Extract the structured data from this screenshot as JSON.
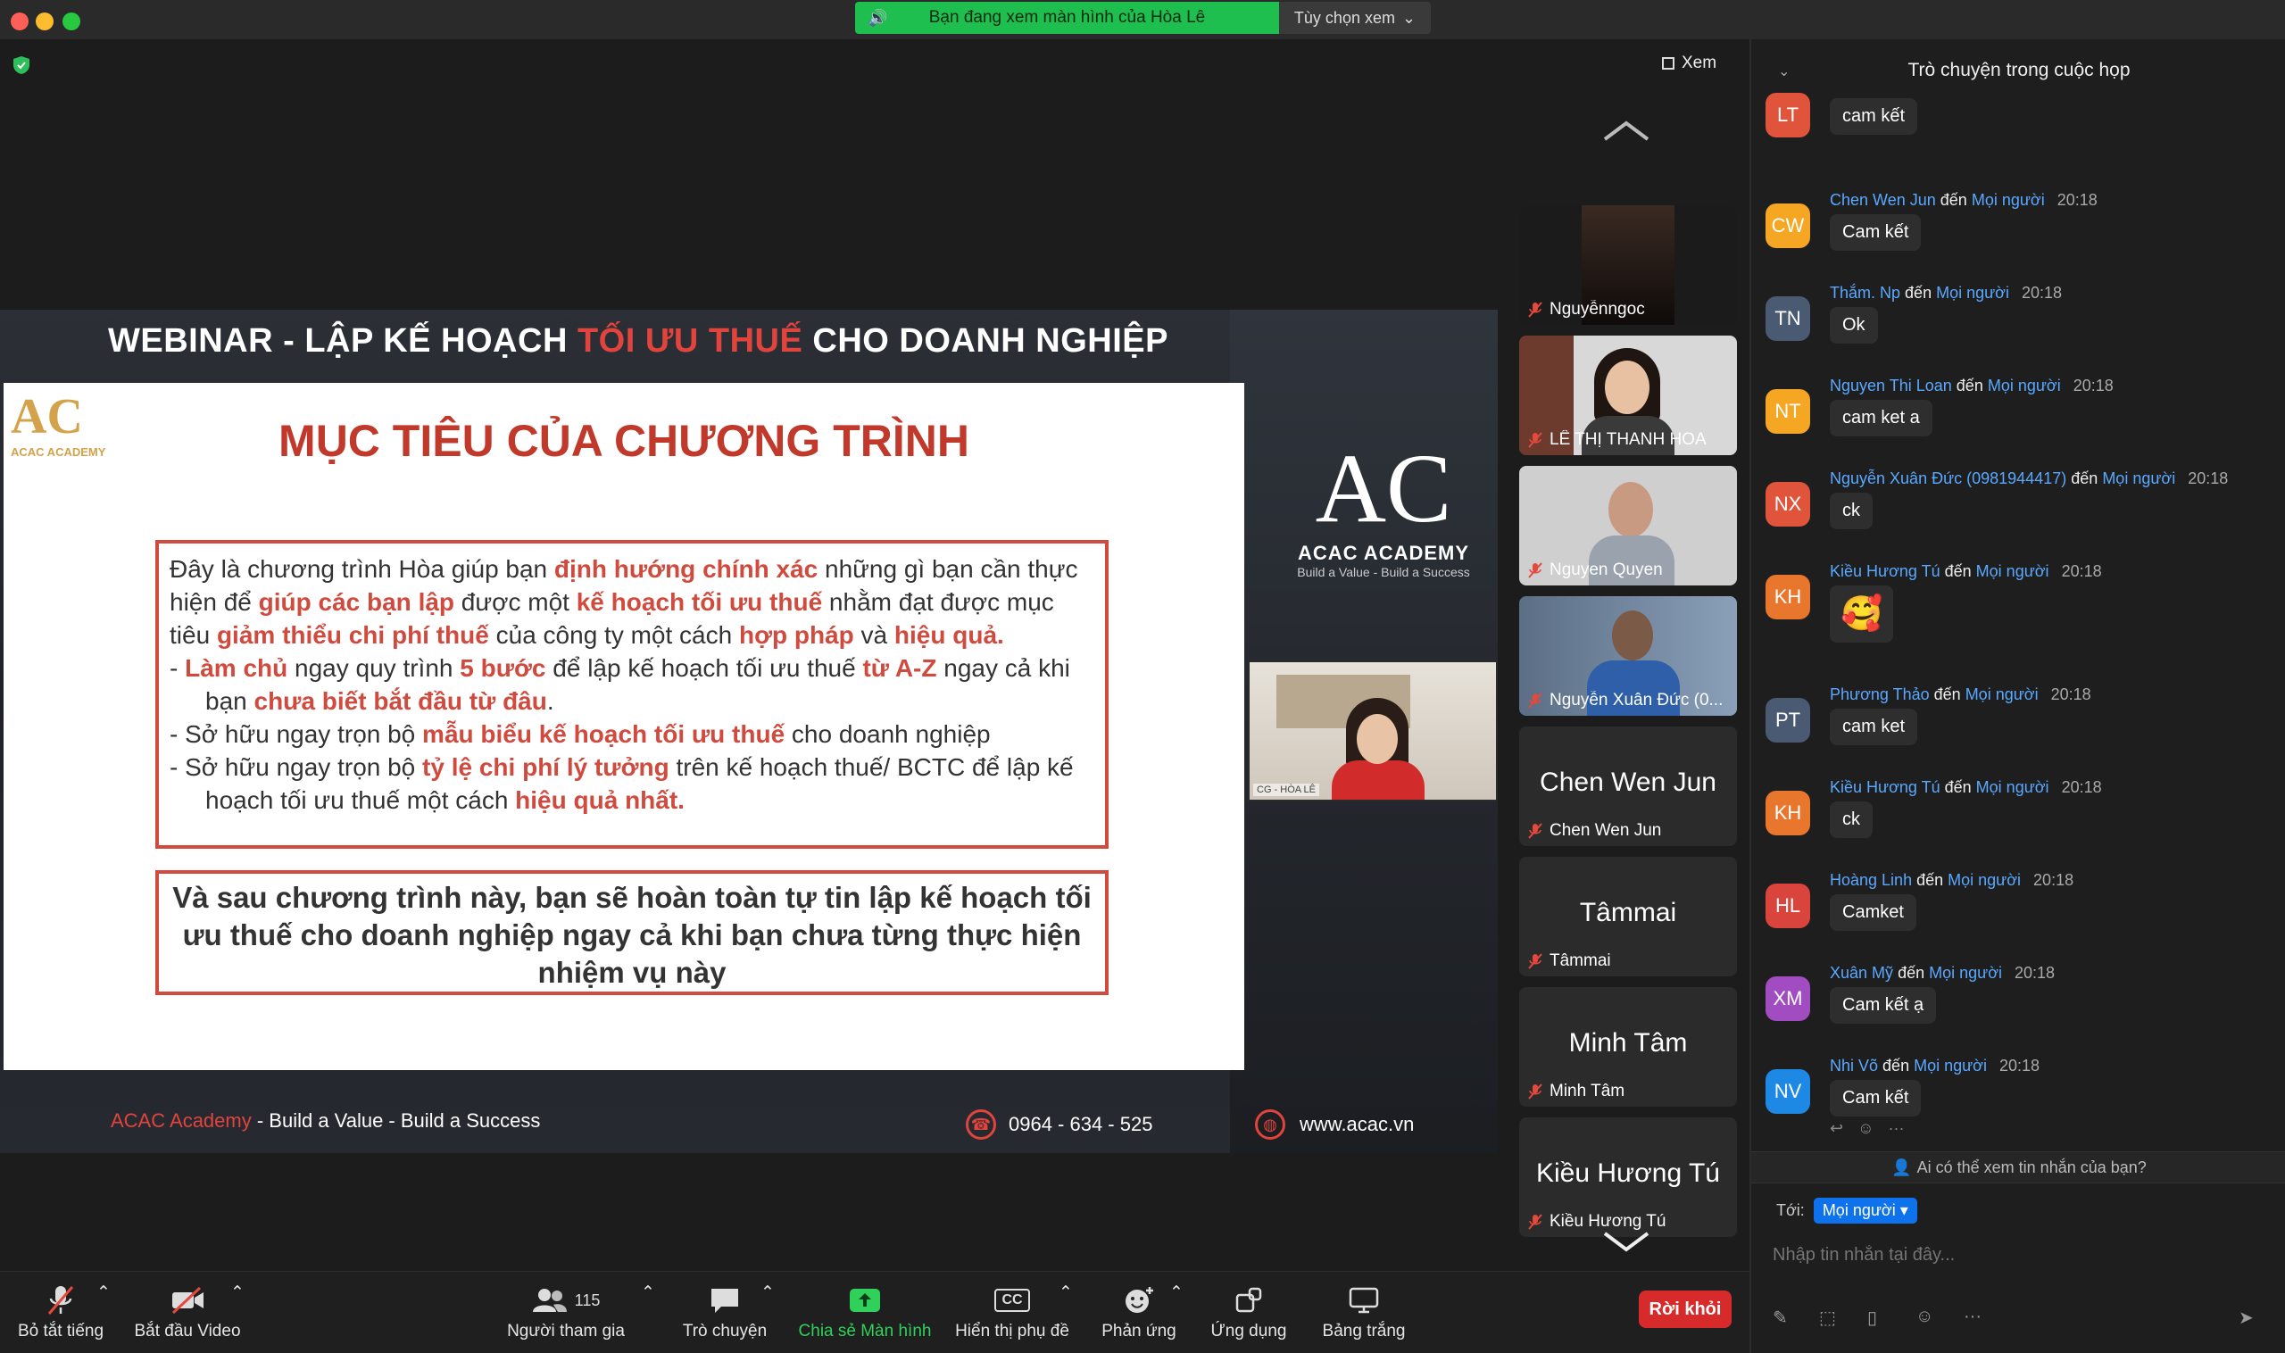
{
  "titlebar": {
    "sharing_banner": "Bạn đang xem màn hình của Hòa Lê",
    "view_options": "Tùy chọn xem"
  },
  "stage": {
    "view_label": "Xem",
    "slide": {
      "title_part1": "WEBINAR - LẬP KẾ HOẠCH ",
      "title_highlight": "TỐI ƯU THUẾ",
      "title_part2": " CHO DOANH NGHIỆP",
      "logo_text": "ACAC ACADEMY",
      "heading": "MỤC TIÊU CỦA CHƯƠNG TRÌNH",
      "box1": {
        "p1": [
          "Đây là chương trình Hòa giúp bạn ",
          "định hướng chính xác",
          " những gì bạn cần thực hiện để ",
          "giúp các bạn lập",
          " được một ",
          "kế hoạch tối ưu thuế",
          " nhằm đạt được mục tiêu ",
          "giảm thiểu chi phí thuế",
          " của công ty một cách ",
          "hợp pháp",
          " và ",
          "hiệu quả."
        ],
        "b1": [
          "- ",
          "Làm chủ",
          " ngay quy trình ",
          "5 bước",
          " để lập kế hoạch tối ưu thuế ",
          "từ A-Z",
          " ngay cả khi bạn ",
          "chưa biết bắt đầu từ đâu",
          "."
        ],
        "b2": [
          "- Sở hữu ngay trọn bộ ",
          "mẫu biểu kế hoạch tối ưu thuế",
          " cho doanh nghiệp"
        ],
        "b3": [
          "- Sở hữu ngay trọn bộ ",
          "tỷ lệ chi phí lý tưởng",
          " trên kế hoạch thuế/ BCTC để lập kế hoạch tối ưu thuế một cách ",
          "hiệu quả nhất."
        ]
      },
      "box2": "Và sau chương trình này, bạn sẽ hoàn toàn tự tin lập kế hoạch tối ưu thuế cho doanh nghiệp ngay cả khi bạn chưa từng thực hiện nhiệm vụ này",
      "brand_name": "ACAC ACADEMY",
      "brand_tag": "Build a Value - Build a Success",
      "footer_brand": "ACAC Academy",
      "footer_slogan": " - Build a Value - Build a Success",
      "footer_phone": "0964 - 634 - 525",
      "footer_web": "www.acac.vn"
    },
    "presenter_tag": "CG - HÒA LÊ"
  },
  "gallery": [
    {
      "name": "Nguyễnngoc",
      "big": "",
      "video": "dark"
    },
    {
      "name": "LÊ THỊ THANH HOA",
      "big": "",
      "video": "woman"
    },
    {
      "name": "Nguyen Quyen",
      "big": "",
      "video": "woman2"
    },
    {
      "name": "Nguyễn Xuân Đức (0...",
      "big": "",
      "video": "man"
    },
    {
      "name": "Chen Wen Jun",
      "big": "Chen Wen Jun",
      "video": "none"
    },
    {
      "name": "Tâmmai",
      "big": "Tâmmai",
      "video": "none"
    },
    {
      "name": "Minh Tâm",
      "big": "Minh Tâm",
      "video": "none"
    },
    {
      "name": "Kiều Hương Tú",
      "big": "Kiều Hương Tú",
      "video": "none"
    }
  ],
  "toolbar": {
    "mute": "Bỏ tắt tiếng",
    "video": "Bắt đầu Video",
    "participants": "Người tham gia",
    "participants_count": "115",
    "chat": "Trò chuyện",
    "share": "Chia sẻ Màn hình",
    "captions": "Hiển thị phụ đề",
    "captions_icon": "CC",
    "reactions": "Phản ứng",
    "apps": "Ứng dụng",
    "whiteboard": "Bảng trắng",
    "leave": "Rời khỏi"
  },
  "chat": {
    "title": "Trò chuyện trong cuộc họp",
    "to_word": "đến",
    "messages": [
      {
        "initials": "LT",
        "color": "#e0543c",
        "sender": "",
        "to": "",
        "time": "",
        "text": "cam kết"
      },
      {
        "initials": "CW",
        "color": "#f5a623",
        "sender": "Chen Wen Jun",
        "to": "Mọi người",
        "time": "20:18",
        "text": "Cam kết"
      },
      {
        "initials": "TN",
        "color": "#4a5a73",
        "sender": "Thắm. Np",
        "to": "Mọi người",
        "time": "20:18",
        "text": "Ok"
      },
      {
        "initials": "NT",
        "color": "#f5a623",
        "sender": "Nguyen Thi Loan",
        "to": "Mọi người",
        "time": "20:18",
        "text": "cam ket a"
      },
      {
        "initials": "NX",
        "color": "#e0543c",
        "sender": "Nguyễn Xuân Đức (0981944417)",
        "to": "Mọi người",
        "time": "20:18",
        "text": "ck"
      },
      {
        "initials": "KH",
        "color": "#e8762c",
        "sender": "Kiều Hương Tú",
        "to": "Mọi người",
        "time": "20:18",
        "text": "🥰"
      },
      {
        "initials": "PT",
        "color": "#4a5a73",
        "sender": "Phương Thảo",
        "to": "Mọi người",
        "time": "20:18",
        "text": "cam ket"
      },
      {
        "initials": "KH",
        "color": "#e8762c",
        "sender": "Kiều Hương Tú",
        "to": "Mọi người",
        "time": "20:18",
        "text": "ck"
      },
      {
        "initials": "HL",
        "color": "#d9453c",
        "sender": "Hoàng Linh",
        "to": "Mọi người",
        "time": "20:18",
        "text": "Camket"
      },
      {
        "initials": "XM",
        "color": "#a14cc0",
        "sender": "Xuân Mỹ",
        "to": "Mọi người",
        "time": "20:18",
        "text": "Cam kết ạ"
      },
      {
        "initials": "NV",
        "color": "#1e88e5",
        "sender": "Nhi Võ",
        "to": "Mọi người",
        "time": "20:18",
        "text": "Cam kết"
      }
    ],
    "who_can_see": "Ai có thể xem tin nhắn của bạn?",
    "to_label": "Tới:",
    "to_value": "Mọi người",
    "input_placeholder": "Nhập tin nhắn tại đây..."
  }
}
